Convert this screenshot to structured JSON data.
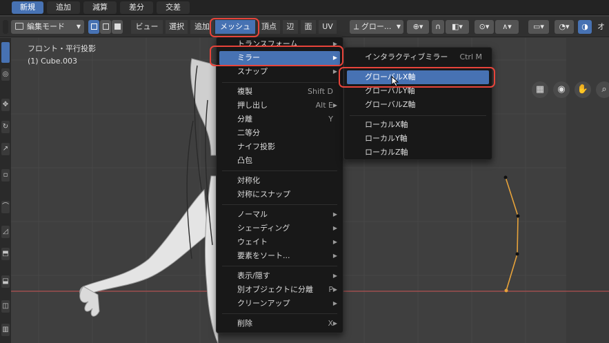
{
  "tabs": [
    {
      "label": "新規",
      "active": true
    },
    {
      "label": "追加",
      "active": false
    },
    {
      "label": "減算",
      "active": false
    },
    {
      "label": "差分",
      "active": false
    },
    {
      "label": "交差",
      "active": false
    }
  ],
  "header": {
    "mode_select": "編集モード",
    "menus": {
      "view": "ビュー",
      "select": "選択",
      "add": "追加",
      "mesh": "メッシュ",
      "vertex": "頂点",
      "edge": "辺",
      "face": "面",
      "uv": "UV"
    },
    "transform_pivot": "グロー...",
    "overlay_right": "オ"
  },
  "viewport": {
    "view_name": "フロント・平行投影",
    "object_name": "(1) Cube.003"
  },
  "mesh_menu": {
    "items": [
      {
        "label": "トランスフォーム",
        "shortcut": "",
        "submenu": true
      },
      {
        "label": "ミラー",
        "shortcut": "",
        "submenu": true,
        "highlighted": true
      },
      {
        "label": "スナップ",
        "shortcut": "",
        "submenu": true
      },
      {
        "label": "複製",
        "shortcut": "Shift D",
        "submenu": false
      },
      {
        "label": "押し出し",
        "shortcut": "Alt E",
        "submenu": true
      },
      {
        "label": "分離",
        "shortcut": "Y",
        "submenu": false
      },
      {
        "label": "二等分",
        "shortcut": "",
        "submenu": false
      },
      {
        "label": "ナイフ投影",
        "shortcut": "",
        "submenu": false
      },
      {
        "label": "凸包",
        "shortcut": "",
        "submenu": false
      },
      {
        "label": "対称化",
        "shortcut": "",
        "submenu": false
      },
      {
        "label": "対称にスナップ",
        "shortcut": "",
        "submenu": false
      },
      {
        "label": "ノーマル",
        "shortcut": "",
        "submenu": true
      },
      {
        "label": "シェーディング",
        "shortcut": "",
        "submenu": true
      },
      {
        "label": "ウェイト",
        "shortcut": "",
        "submenu": true
      },
      {
        "label": "要素をソート...",
        "shortcut": "",
        "submenu": true
      },
      {
        "label": "表示/隠す",
        "shortcut": "",
        "submenu": true
      },
      {
        "label": "別オブジェクトに分離",
        "shortcut": "P",
        "submenu": true
      },
      {
        "label": "クリーンアップ",
        "shortcut": "",
        "submenu": true
      },
      {
        "label": "削除",
        "shortcut": "X",
        "submenu": true
      }
    ]
  },
  "mirror_menu": {
    "items": [
      {
        "label": "インタラクティブミラー",
        "shortcut": "Ctrl M"
      },
      {
        "label": "グローバルX軸",
        "shortcut": "",
        "highlighted": true
      },
      {
        "label": "グローバルY軸",
        "shortcut": ""
      },
      {
        "label": "グローバルZ軸",
        "shortcut": ""
      },
      {
        "label": "ローカルX軸",
        "shortcut": ""
      },
      {
        "label": "ローカルY軸",
        "shortcut": ""
      },
      {
        "label": "ローカルZ軸",
        "shortcut": ""
      }
    ]
  },
  "colors": {
    "accent": "#4772b3",
    "highlight_ring": "#e8443a",
    "x_axis": "#c05656",
    "edge_select": "#e8a33a"
  },
  "icons": [
    "mode-icon",
    "grid-icon",
    "camera-icon",
    "hand-icon",
    "zoom-icon",
    "mouse-cursor-icon"
  ]
}
